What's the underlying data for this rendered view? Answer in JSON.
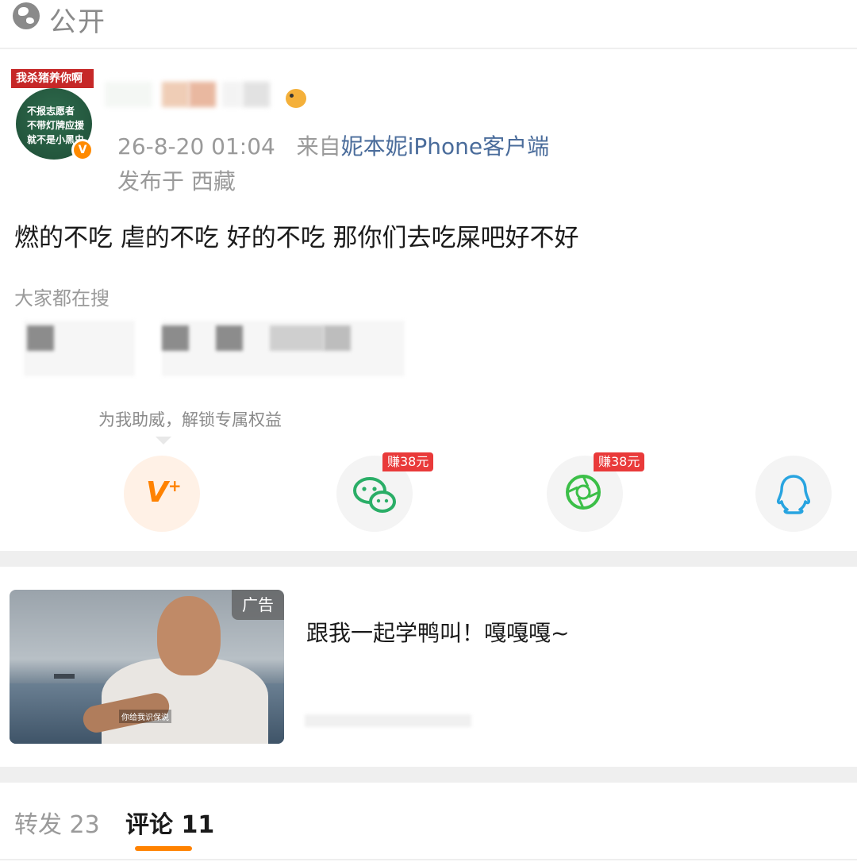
{
  "topbar": {
    "visibility_label": "公开",
    "icon": "globe-icon"
  },
  "post": {
    "avatar": {
      "tag_text": "我杀猪养你啊",
      "lines": [
        "不报志愿者",
        "不带灯牌应援",
        "就不是小黑虫"
      ],
      "badge": "V"
    },
    "time": "26-8-20 01:04",
    "source_prefix": "来自",
    "source": "妮本妮iPhone客户端",
    "location_prefix": "发布于",
    "location": "西藏",
    "text": "燃的不吃 虐的不吃 好的不吃 那你们去吃屎吧好不好"
  },
  "trending": {
    "label": "大家都在搜"
  },
  "share": {
    "boost_tip": "为我助威，解锁专属权益",
    "buttons": [
      {
        "name": "v-plus",
        "icon": "v-plus-icon",
        "glyph": "V",
        "plus": "+"
      },
      {
        "name": "wechat",
        "icon": "wechat-icon",
        "badge": "赚38元"
      },
      {
        "name": "moments",
        "icon": "moments-icon",
        "badge": "赚38元"
      },
      {
        "name": "qq",
        "icon": "qq-icon"
      }
    ]
  },
  "ad": {
    "tag": "广告",
    "title": "跟我一起学鸭叫！嘎嘎嘎~",
    "subtitle": "你给我识保说"
  },
  "tabs": [
    {
      "label": "转发",
      "count": "23",
      "active": false
    },
    {
      "label": "评论",
      "count": "11",
      "active": true
    }
  ],
  "colors": {
    "accent": "#ff8200",
    "link": "#4a6c9b",
    "badge_red": "#e93a3a",
    "wechat_green": "#2aae67"
  }
}
